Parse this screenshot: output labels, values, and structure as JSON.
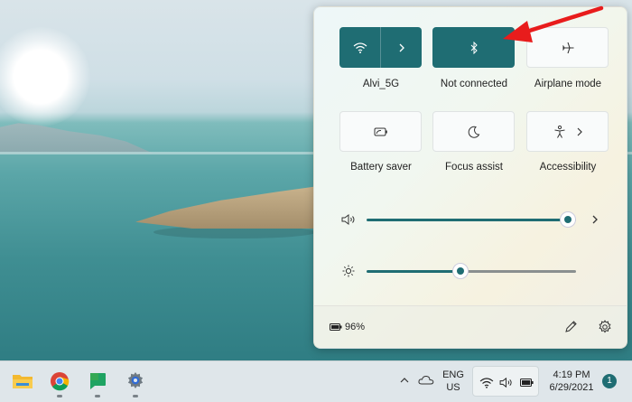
{
  "quick_settings": {
    "tiles": [
      {
        "id": "wifi",
        "label": "Alvi_5G",
        "icon": "wifi-icon",
        "state": "on",
        "has_chevron": true
      },
      {
        "id": "bluetooth",
        "label": "Not connected",
        "icon": "bluetooth-icon",
        "state": "on",
        "has_chevron": false
      },
      {
        "id": "airplane",
        "label": "Airplane mode",
        "icon": "airplane-icon",
        "state": "off",
        "has_chevron": false
      },
      {
        "id": "battery_saver",
        "label": "Battery saver",
        "icon": "battery-saver-icon",
        "state": "off",
        "has_chevron": false
      },
      {
        "id": "focus_assist",
        "label": "Focus assist",
        "icon": "moon-icon",
        "state": "off",
        "has_chevron": false
      },
      {
        "id": "accessibility",
        "label": "Accessibility",
        "icon": "accessibility-icon",
        "state": "off",
        "has_chevron": true
      }
    ],
    "volume": {
      "icon": "speaker-icon",
      "level_fraction": 0.98
    },
    "brightness": {
      "icon": "sun-icon",
      "level_fraction": 0.45
    },
    "battery": {
      "icon": "battery-icon",
      "percent": "96%"
    },
    "footer": {
      "edit_icon": "pencil-icon",
      "settings_icon": "gear-icon"
    }
  },
  "taskbar": {
    "apps": [
      {
        "name": "File Explorer",
        "icon": "folder-icon"
      },
      {
        "name": "Google Chrome",
        "icon": "chrome-icon"
      },
      {
        "name": "Google Chat",
        "icon": "chat-icon"
      },
      {
        "name": "Settings",
        "icon": "gear-icon"
      }
    ],
    "tray": {
      "language_top": "ENG",
      "language_bottom": "US",
      "time": "4:19 PM",
      "date": "6/29/2021",
      "notification_count": "1"
    }
  },
  "colors": {
    "accent": "#1f6d73",
    "annotation_arrow": "#e81c1c"
  }
}
